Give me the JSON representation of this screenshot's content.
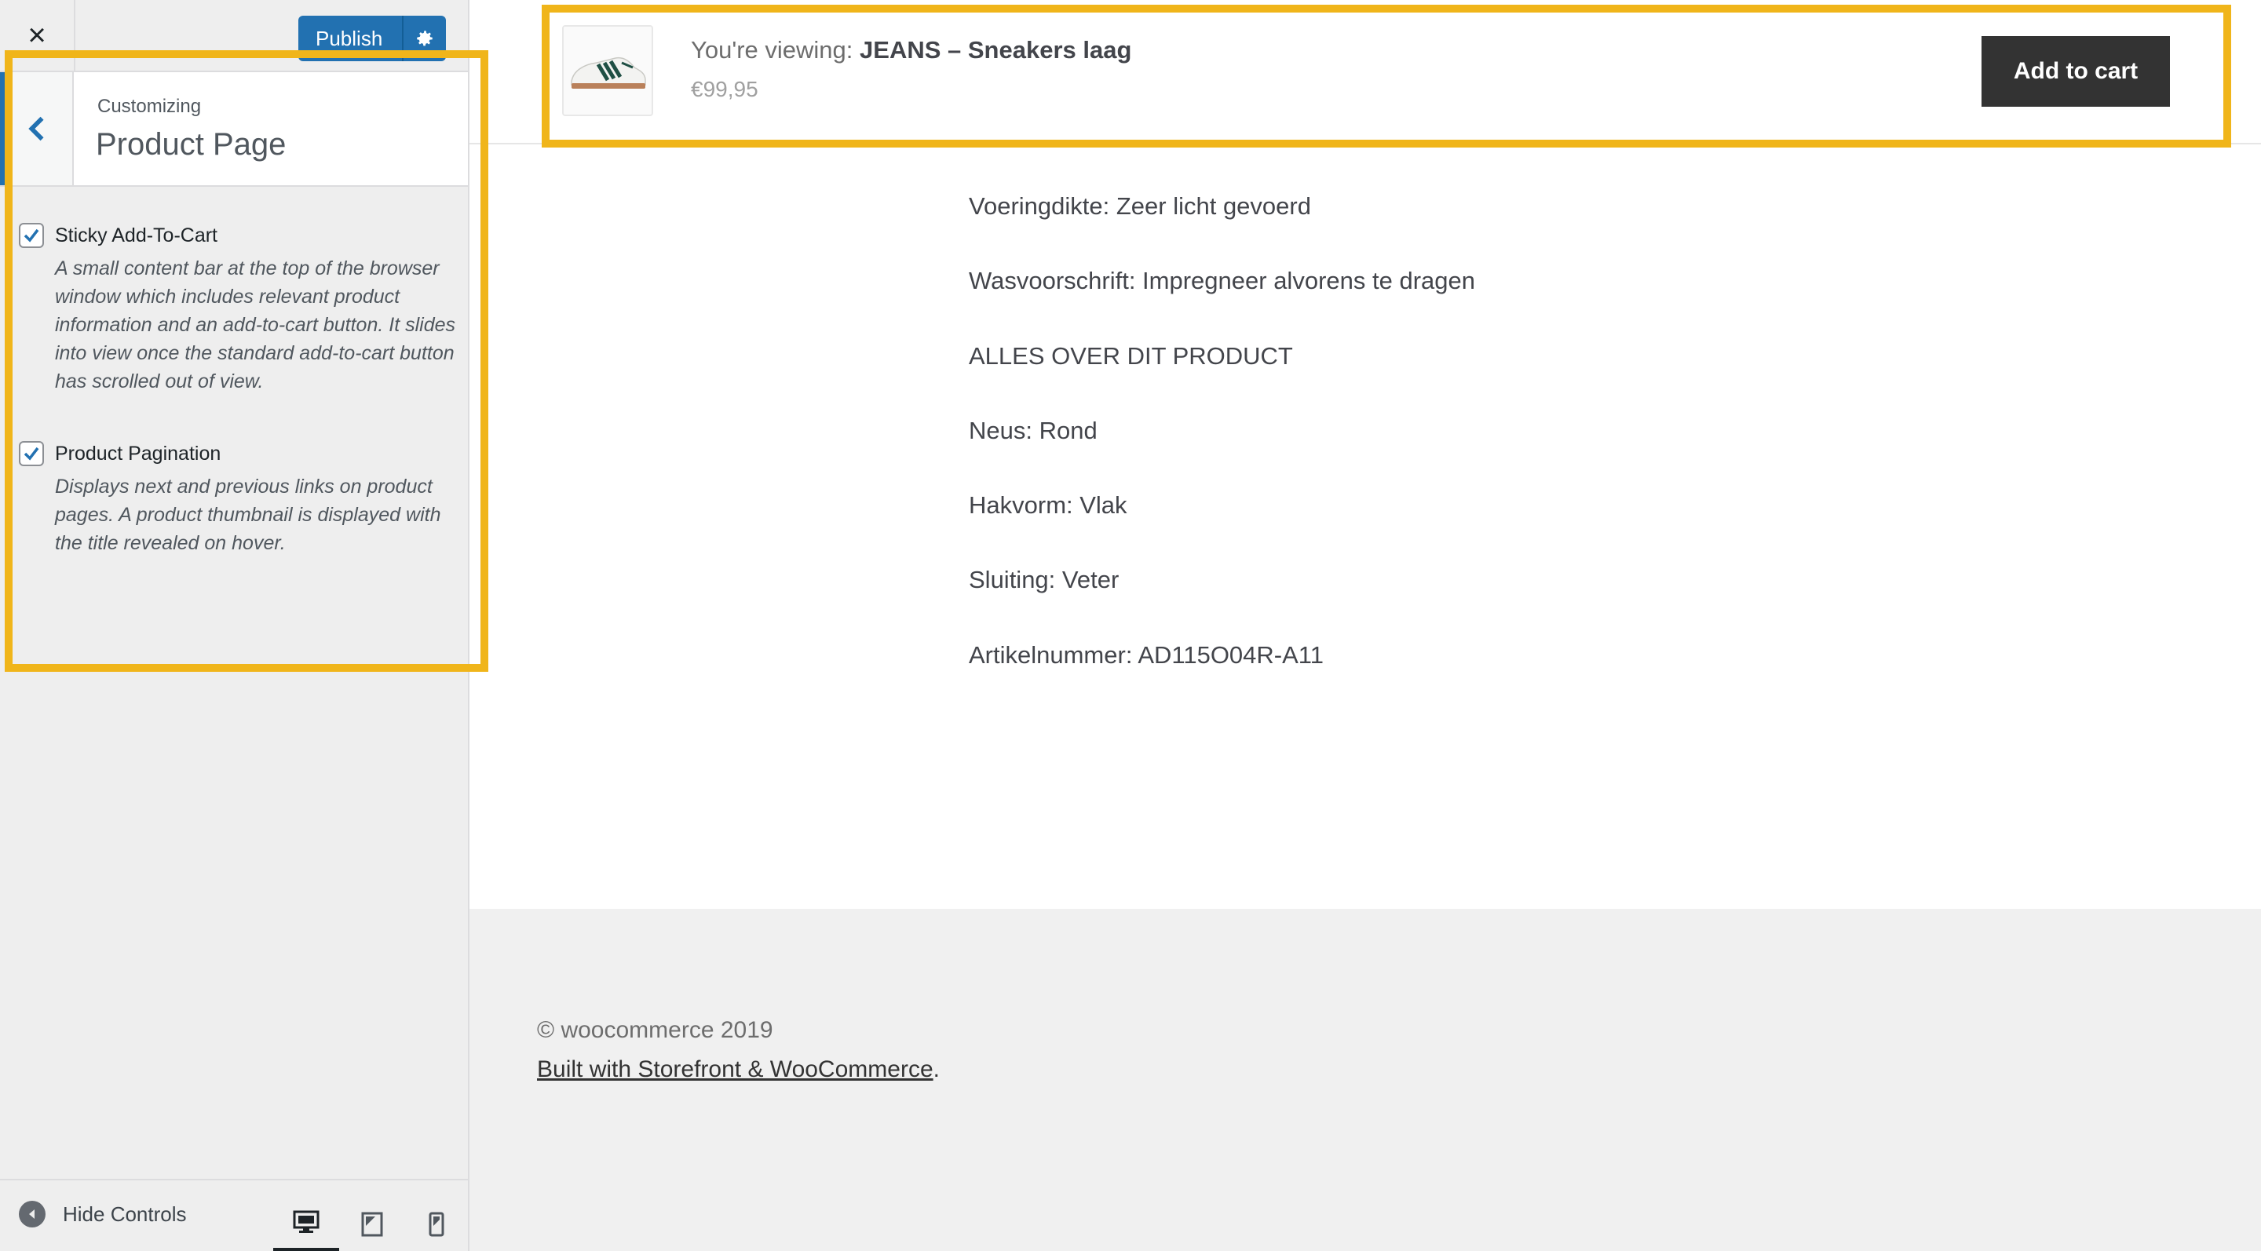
{
  "customizer": {
    "close_label": "×",
    "publish_label": "Publish",
    "breadcrumb": "Customizing",
    "section_title": "Product Page",
    "controls": [
      {
        "label": "Sticky Add-To-Cart",
        "checked": true,
        "description": "A small content bar at the top of the browser window which includes relevant product information and an add-to-cart button. It slides into view once the standard add-to-cart button has scrolled out of view."
      },
      {
        "label": "Product Pagination",
        "checked": true,
        "description": "Displays next and previous links on product pages. A product thumbnail is displayed with the title revealed on hover."
      }
    ],
    "footer": {
      "hide_controls_label": "Hide Controls",
      "devices": [
        "desktop-icon",
        "tablet-icon",
        "mobile-icon"
      ],
      "active_device": "desktop"
    }
  },
  "preview": {
    "sticky_bar": {
      "viewing_prefix": "You're viewing: ",
      "product_name": "JEANS – Sneakers laag",
      "price": "€99,95",
      "add_to_cart_label": "Add to cart"
    },
    "content_lines": [
      "Voeringdikte: Zeer licht gevoerd",
      "Wasvoorschrift: Impregneer alvorens te dragen",
      "ALLES OVER DIT PRODUCT",
      "Neus: Rond",
      "Hakvorm: Vlak",
      "Sluiting: Veter",
      "Artikelnummer: AD115O04R-A11"
    ],
    "footer": {
      "copyright": "© woocommerce 2019",
      "built_with_link": "Built with Storefront & WooCommerce",
      "built_with_suffix": "."
    }
  },
  "colors": {
    "highlight": "#f0b51a",
    "publish_blue": "#2271b1",
    "cart_button": "#333333",
    "sidebar_bg": "#eeeeee",
    "footer_bg": "#f0f0f0"
  }
}
